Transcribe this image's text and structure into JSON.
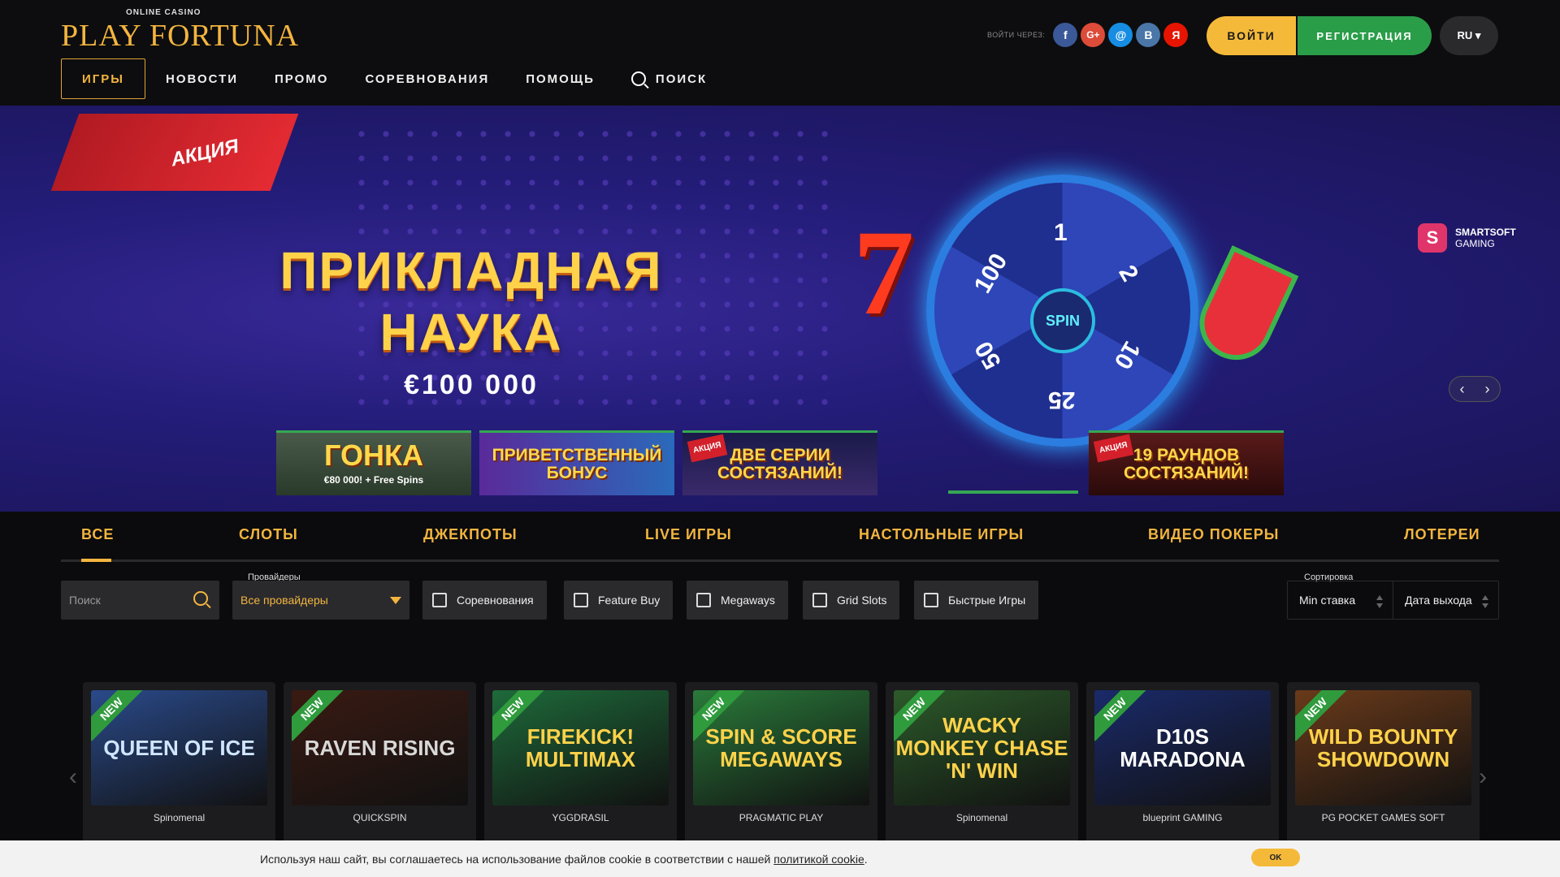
{
  "header": {
    "logo_small": "ONLINE CASINO",
    "logo_big": "PLAY FORTUNA",
    "social_label": "ВОЙТИ ЧЕРЕЗ:",
    "social": [
      {
        "icon": "facebook-icon",
        "glyph": "f",
        "color": "#3b5998"
      },
      {
        "icon": "google-plus-icon",
        "glyph": "G+",
        "color": "#dd4b39"
      },
      {
        "icon": "mailru-icon",
        "glyph": "@",
        "color": "#168de2"
      },
      {
        "icon": "vk-icon",
        "glyph": "В",
        "color": "#4a76a8"
      },
      {
        "icon": "yandex-icon",
        "glyph": "Я",
        "color": "#e61400"
      }
    ],
    "login": "ВОЙТИ",
    "register": "РЕГИСТРАЦИЯ",
    "lang": "RU ▾"
  },
  "nav": {
    "items": [
      "ИГРЫ",
      "НОВОСТИ",
      "ПРОМО",
      "СОРЕВНОВАНИЯ",
      "ПОМОЩЬ"
    ],
    "search": "ПОИСК"
  },
  "banner": {
    "ribbon": "АКЦИЯ",
    "title_line1": "ПРИКЛАДНАЯ",
    "title_line2": "НАУКА",
    "amount": "€100 000",
    "provider": {
      "line1": "SMARTSOFT",
      "line2": "GAMING"
    },
    "wheel": {
      "spin": "SPIN",
      "segments": [
        "1",
        "2",
        "10",
        "25",
        "50",
        "100"
      ]
    },
    "thumbnails": [
      {
        "title": "ГОНКА",
        "subtitle": "€80 000! + Free Spins",
        "tag": ""
      },
      {
        "title": "ПРИВЕТСТВЕННЫЙ БОНУС",
        "subtitle": "",
        "tag": ""
      },
      {
        "title": "ДВЕ СЕРИИ СОСТЯЗАНИЙ!",
        "subtitle": "",
        "tag": "АКЦИЯ"
      },
      {
        "title": "19 РАУНДОВ СОСТЯЗАНИЙ!",
        "subtitle": "",
        "tag": "АКЦИЯ"
      }
    ]
  },
  "categories": [
    "ВСЕ",
    "СЛОТЫ",
    "ДЖЕКПОТЫ",
    "LIVE ИГРЫ",
    "НАСТОЛЬНЫЕ ИГРЫ",
    "ВИДЕО ПОКЕРЫ",
    "ЛОТЕРЕИ"
  ],
  "filters": {
    "search_placeholder": "Поиск",
    "providers_label": "Провайдеры",
    "providers_value": "Все провайдеры",
    "chips": [
      "Соревнования",
      "Feature Buy",
      "Megaways",
      "Grid Slots",
      "Быстрые Игры"
    ],
    "sort_label": "Сортировка",
    "sort_options": [
      "Min ставка",
      "Дата выхода"
    ]
  },
  "games": [
    {
      "title": "QUEEN OF ICE",
      "provider": "Spinomenal",
      "tag": "NEW",
      "bg": "#2a4a8a",
      "fg": "#cfe6ff"
    },
    {
      "title": "RAVEN RISING",
      "provider": "QUICKSPIN",
      "tag": "NEW",
      "bg": "#3a1a12",
      "fg": "#d8d8d8"
    },
    {
      "title": "FIREKICK! MULTIMAX",
      "provider": "YGGDRASIL",
      "tag": "NEW",
      "bg": "#1e6a3a",
      "fg": "#ffd24a"
    },
    {
      "title": "SPIN & SCORE MEGAWAYS",
      "provider": "PRAGMATIC PLAY",
      "tag": "NEW",
      "bg": "#2a7a3a",
      "fg": "#ffd24a"
    },
    {
      "title": "WACKY MONKEY CHASE 'N' WIN",
      "provider": "Spinomenal",
      "tag": "NEW",
      "bg": "#2c5a2a",
      "fg": "#ffd24a"
    },
    {
      "title": "D10S MARADONA",
      "provider": "blueprint GAMING",
      "tag": "NEW",
      "bg": "#1a2a6a",
      "fg": "#ffffff"
    },
    {
      "title": "WILD BOUNTY SHOWDOWN",
      "provider": "PG POCKET GAMES SOFT",
      "tag": "NEW",
      "bg": "#6a3a1a",
      "fg": "#ffd24a"
    }
  ],
  "cookie": {
    "text": "Используя наш сайт, вы соглашаетесь на использование файлов cookie в соответствии с нашей ",
    "link": "политикой cookie",
    "end": ".",
    "button": "OK"
  }
}
